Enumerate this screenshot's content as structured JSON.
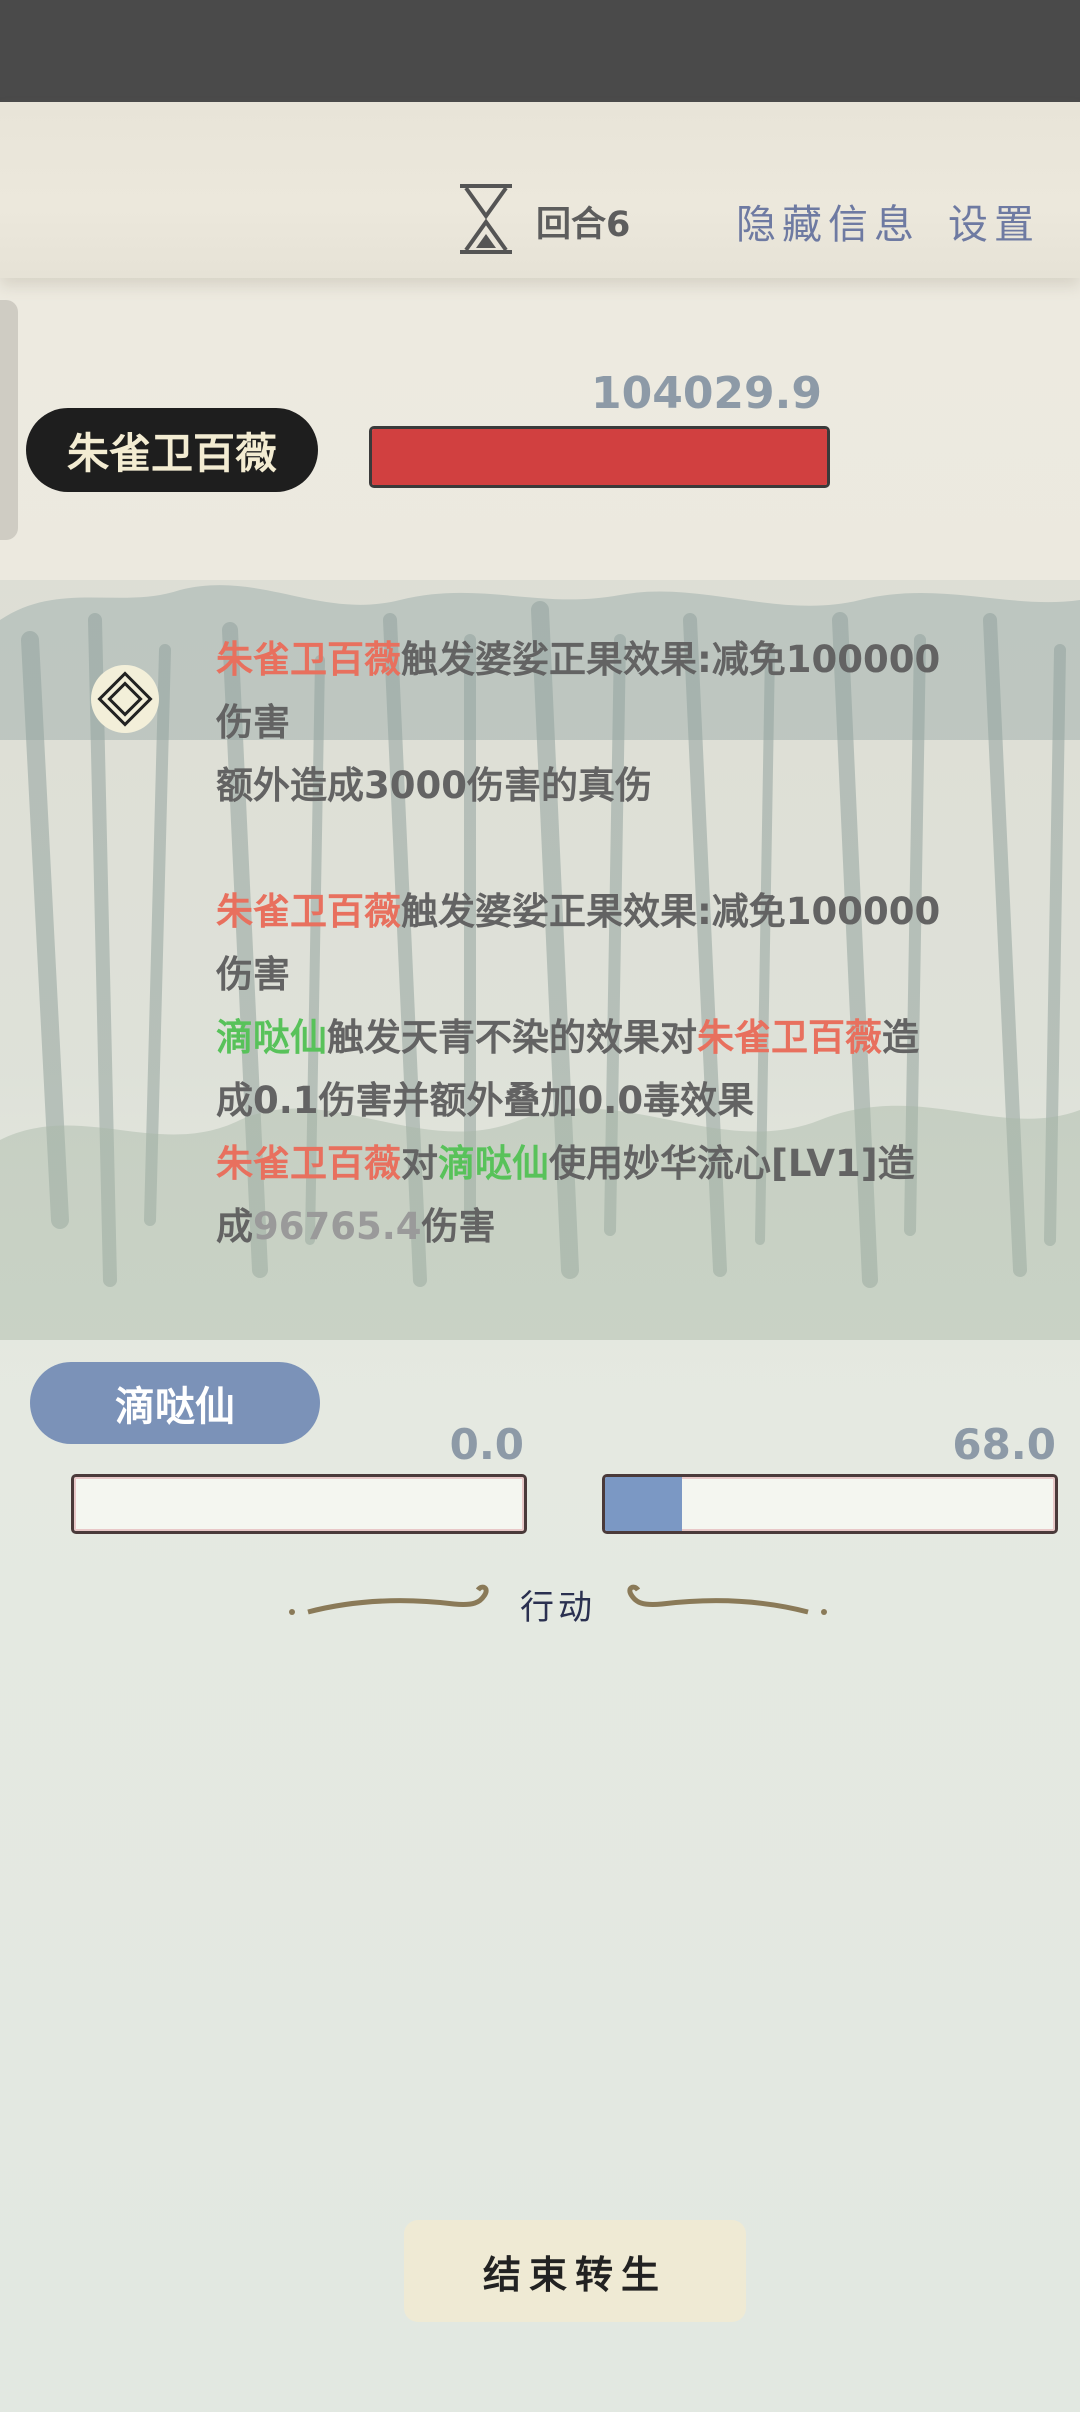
{
  "header": {
    "round_label": "回合6",
    "hide_info_label": "隐藏信息",
    "settings_label": "设置"
  },
  "enemy": {
    "name": "朱雀卫百薇",
    "hp_value": "104029.9",
    "hp_fraction": 1.0,
    "hp_color": "#d14040"
  },
  "battle_log": {
    "entry1": {
      "line1": {
        "actor": "朱雀卫百薇",
        "text": "触发婆娑正果效果:减免100000"
      },
      "line2": {
        "text": "伤害"
      },
      "line3": {
        "text": "额外造成3000伤害的真伤"
      }
    },
    "entry2": {
      "line1": {
        "actor": "朱雀卫百薇",
        "text": "触发婆娑正果效果:减免100000"
      },
      "line2": {
        "text": "伤害"
      },
      "line3": {
        "actor": "滴哒仙",
        "text": "触发天青不染的效果对",
        "target": "朱雀卫百薇",
        "tail": "造"
      },
      "line4": {
        "text": "成0.1伤害并额外叠加0.0毒效果"
      },
      "line5": {
        "actor": "朱雀卫百薇",
        "mid": "对",
        "target": "滴哒仙",
        "text": "使用妙华流心[LV1]造"
      },
      "line6": {
        "prefix": "成",
        "value": "96765.4",
        "suffix": "伤害"
      }
    },
    "colors": {
      "enemy": "#e8705e",
      "player": "#58c25a",
      "text": "#636363"
    }
  },
  "player": {
    "name": "滴哒仙",
    "hp_value": "0.0",
    "hp_fraction": 0.0,
    "energy_value": "68.0",
    "energy_fraction": 0.17
  },
  "action": {
    "label": "行动"
  },
  "end_button": {
    "label": "结束转生"
  }
}
